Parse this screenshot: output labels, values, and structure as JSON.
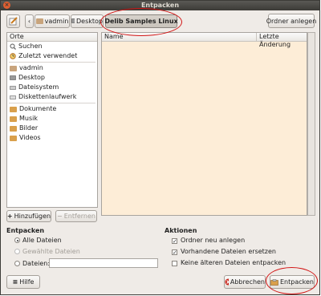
{
  "window": {
    "title": "Entpacken"
  },
  "toolbar": {
    "edit_icon": "edit-pencil-icon",
    "back_label": "‹",
    "crumbs": [
      {
        "label": "vadmin",
        "icon": "home-folder-icon"
      },
      {
        "label": "Desktop",
        "icon": "desktop-icon"
      },
      {
        "label": "Delib Samples Linux",
        "icon": ""
      }
    ],
    "create_folder_label": "Ordner anlegen"
  },
  "places": {
    "header": "Orte",
    "items_top": [
      {
        "label": "Suchen",
        "icon": "search-icon"
      },
      {
        "label": "Zuletzt verwendet",
        "icon": "recent-icon"
      }
    ],
    "items_mid": [
      {
        "label": "vadmin",
        "icon": "home-folder-icon"
      },
      {
        "label": "Desktop",
        "icon": "desktop-icon"
      },
      {
        "label": "Dateisystem",
        "icon": "drive-icon"
      },
      {
        "label": "Diskettenlaufwerk",
        "icon": "floppy-icon"
      }
    ],
    "items_bottom": [
      {
        "label": "Dokumente",
        "icon": "folder-icon"
      },
      {
        "label": "Musik",
        "icon": "folder-icon"
      },
      {
        "label": "Bilder",
        "icon": "folder-icon"
      },
      {
        "label": "Videos",
        "icon": "folder-icon"
      }
    ],
    "add_label": "Hinzufügen",
    "remove_label": "Entfernen"
  },
  "files": {
    "col_name": "Name",
    "col_modified": "Letzte Änderung"
  },
  "extract": {
    "title": "Entpacken",
    "all_files": "Alle Dateien",
    "selected_files": "Gewählte Dateien",
    "files_label": "Dateien:",
    "files_value": ""
  },
  "actions": {
    "title": "Aktionen",
    "create_folders": "Ordner neu anlegen",
    "overwrite": "Vorhandene Dateien ersetzen",
    "no_older": "Keine älteren Dateien entpacken"
  },
  "buttons": {
    "help": "Hilfe",
    "cancel": "Abbrechen",
    "extract": "Entpacken"
  },
  "colors": {
    "annotation": "#d21414",
    "file_area_bg": "#fdedd7",
    "titlebar": "#3c3b37"
  }
}
